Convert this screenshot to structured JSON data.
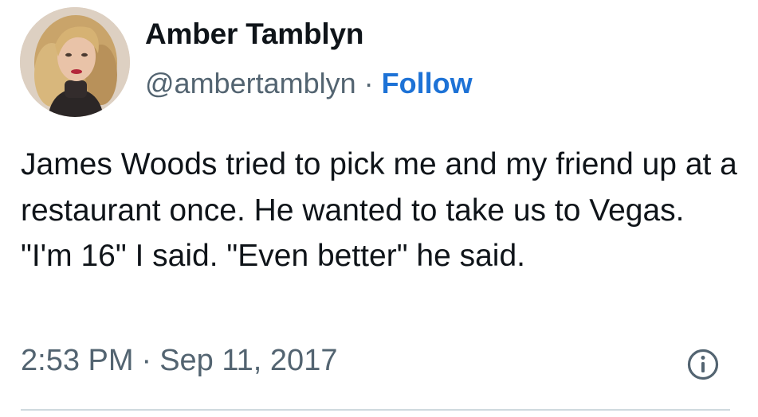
{
  "author": {
    "display_name": "Amber Tamblyn",
    "handle": "@ambertamblyn",
    "separator": "·",
    "follow_label": "Follow"
  },
  "tweet": {
    "text": "James Woods tried to pick me and my friend up at a restaurant once. He wanted to take us to Vegas. \"I'm 16\" I said. \"Even better\" he said.",
    "time": "2:53 PM",
    "separator": "·",
    "date": "Sep 11, 2017"
  },
  "icons": {
    "info": "info-circle-icon"
  },
  "colors": {
    "follow_link": "#1d72d6",
    "secondary_text": "#536471",
    "primary_text": "#0f1419",
    "divider": "#cfd9de"
  }
}
